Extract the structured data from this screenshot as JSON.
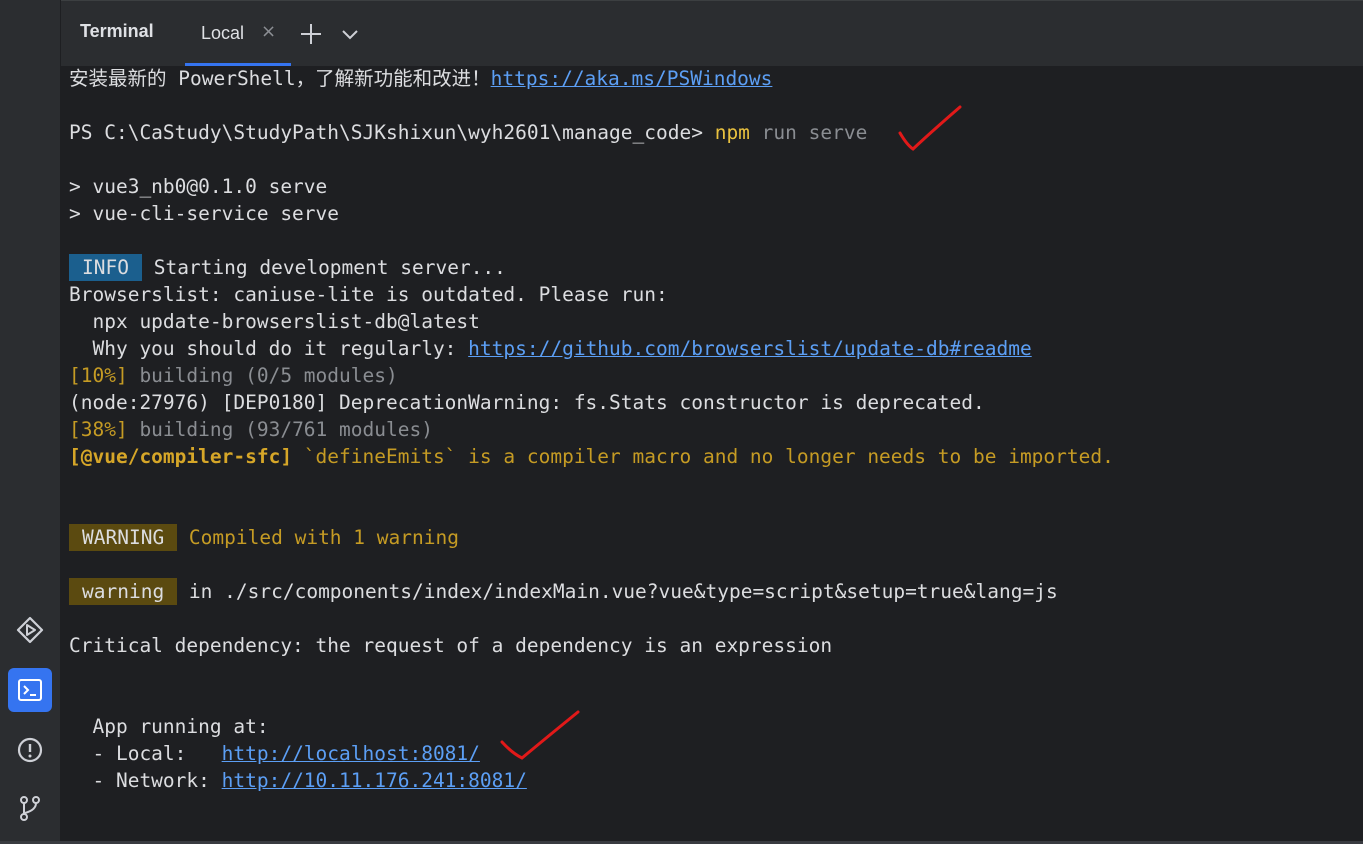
{
  "window": {
    "tool_title": "Terminal",
    "tab": {
      "label": "Local",
      "close_glyph": "×"
    },
    "toolbar_icons": [
      "plus-icon",
      "chevron-down-icon"
    ]
  },
  "sidebar": {
    "icons": [
      "run-icon",
      "terminal-icon",
      "problems-icon",
      "git-icon"
    ],
    "active": "terminal-icon"
  },
  "terminal": {
    "l1_text": "安装最新的 PowerShell，了解新功能和改进！",
    "l1_link": "https://aka.ms/PSWindows",
    "prompt": "PS C:\\CaStudy\\StudyPath\\SJKshixun\\wyh2601\\manage_code> ",
    "cmd_npm": "npm",
    "cmd_args": " run serve",
    "l3": "> vue3_nb0@0.1.0 serve",
    "l4": "> vue-cli-service serve",
    "info_badge": "INFO",
    "info_text": " Starting development server...",
    "bl1": "Browserslist: caniuse-lite is outdated. Please run:",
    "bl2": "  npx update-browserslist-db@latest",
    "bl3_text": "  Why you should do it regularly: ",
    "bl3_link": "https://github.com/browserslist/update-db#readme",
    "b10_pct": "[10%]",
    "b10_text": " building (0/5 modules)",
    "dep": "(node:27976) [DEP0180] DeprecationWarning: fs.Stats constructor is deprecated.",
    "b38_pct": "[38%]",
    "b38_text": " building (93/761 modules)",
    "sfc_tag": "[@vue/compiler-sfc]",
    "sfc_text": " `defineEmits` is a compiler macro and no longer needs to be imported.",
    "warning_badge": "WARNING",
    "compiled": " Compiled with 1 warning",
    "warning2_badge": "warning",
    "warn_path": " in ./src/components/index/indexMain.vue?vue&type=script&setup=true&lang=js",
    "critical": "Critical dependency: the request of a dependency is an expression",
    "app_running": "  App running at:",
    "local_label": "  - Local:   ",
    "local_url": "http://localhost:8081/",
    "network_label": "  - Network: ",
    "network_url": "http://10.11.176.241:8081/"
  },
  "colors": {
    "background": "#1e1f22",
    "panel": "#2b2d30",
    "accent": "#3574f0",
    "link": "#5c9ff5",
    "command": "#e9c13f",
    "warning_text": "#c59b24",
    "check_marks": "#e11919"
  }
}
